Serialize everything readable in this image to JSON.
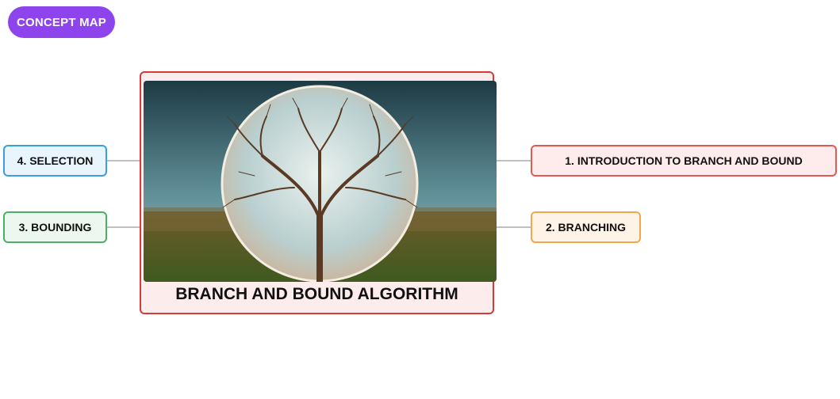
{
  "header": {
    "badge_label": "CONCEPT MAP"
  },
  "central": {
    "title": "BRANCH AND BOUND ALGORITHM",
    "image": "tree-in-glass-sphere"
  },
  "nodes": [
    {
      "label": "1. INTRODUCTION TO BRANCH AND BOUND",
      "color": "#e35a55"
    },
    {
      "label": "2. BRANCHING",
      "color": "#f4a64b"
    },
    {
      "label": "3. BOUNDING",
      "color": "#4caf63"
    },
    {
      "label": "4. SELECTION",
      "color": "#3a9ee0"
    }
  ],
  "colors": {
    "accent": "#8e44ec",
    "central_border": "#d63a3a",
    "connector": "#9a9a9a"
  }
}
